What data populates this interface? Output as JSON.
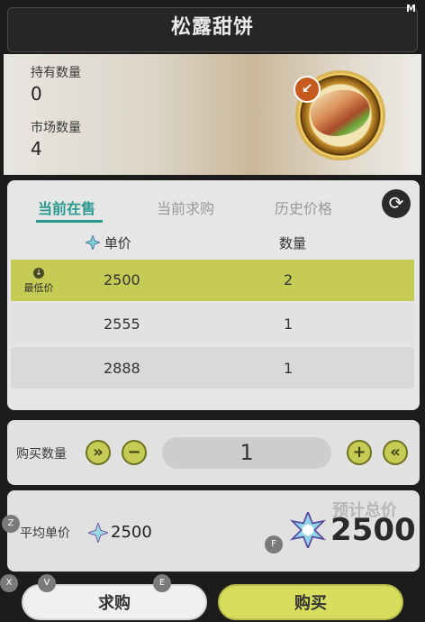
{
  "window": {
    "title": "松露甜饼",
    "hotkey_close": "M"
  },
  "item": {
    "owned_label": "持有数量",
    "owned_value": "0",
    "market_label": "市场数量",
    "market_value": "4",
    "icon": "wrap-food-icon"
  },
  "tabs": [
    {
      "label": "当前在售",
      "active": true
    },
    {
      "label": "当前求购",
      "active": false
    },
    {
      "label": "历史价格",
      "active": false
    }
  ],
  "table": {
    "headers": {
      "price": "单价",
      "quantity": "数量"
    },
    "lowest_label": "最低价",
    "rows": [
      {
        "price": "2500",
        "quantity": "2"
      },
      {
        "price": "2555",
        "quantity": "1"
      },
      {
        "price": "2888",
        "quantity": "1"
      }
    ]
  },
  "purchase": {
    "qty_label": "购买数量",
    "qty_value": "1"
  },
  "pricing": {
    "avg_label": "平均单价",
    "avg_value": "2500",
    "total_label": "预计总价",
    "total_value": "2500"
  },
  "keys": {
    "z": "Z",
    "x": "X",
    "v": "V",
    "e": "E",
    "f": "F"
  },
  "buttons": {
    "request": "求购",
    "buy": "购买"
  },
  "colors": {
    "accent": "#2a9a8e",
    "highlight": "#c6cb55"
  }
}
